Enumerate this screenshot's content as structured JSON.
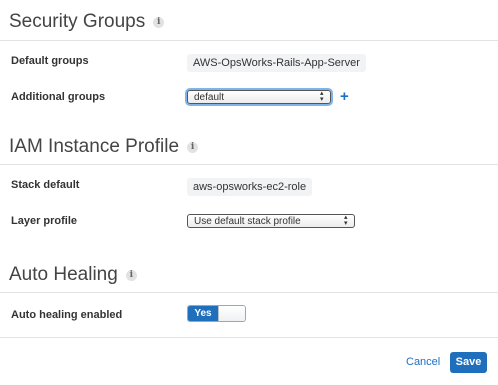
{
  "security_groups": {
    "title": "Security Groups",
    "info_icon": "i",
    "default_groups_label": "Default groups",
    "default_groups_value": "AWS-OpsWorks-Rails-App-Server",
    "additional_groups_label": "Additional groups",
    "additional_groups_selected": "default",
    "add_icon": "+"
  },
  "iam": {
    "title": "IAM Instance Profile",
    "info_icon": "i",
    "stack_default_label": "Stack default",
    "stack_default_value": "aws-opsworks-ec2-role",
    "layer_profile_label": "Layer profile",
    "layer_profile_selected": "Use default stack profile"
  },
  "auto_healing": {
    "title": "Auto Healing",
    "info_icon": "i",
    "enabled_label": "Auto healing enabled",
    "toggle_on_label": "Yes",
    "enabled": true
  },
  "footer": {
    "cancel_label": "Cancel",
    "save_label": "Save"
  },
  "colors": {
    "accent": "#1f6fbd",
    "link": "#1a6fc6"
  }
}
